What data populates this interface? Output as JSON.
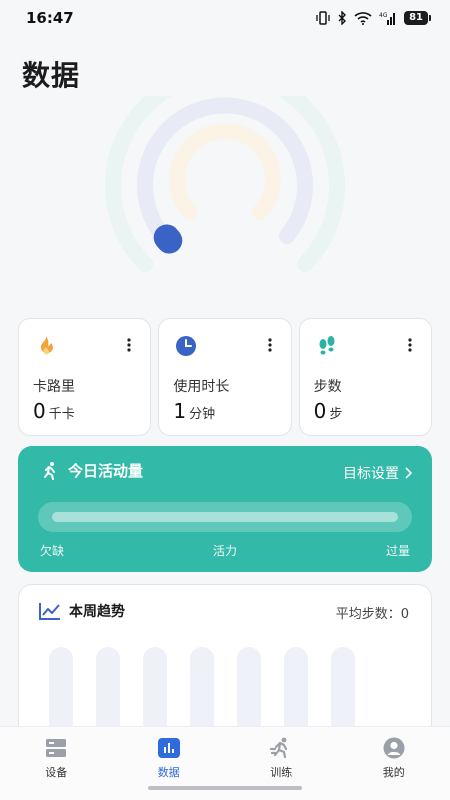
{
  "status": {
    "time": "16:47",
    "battery": "81"
  },
  "page_title": "数据",
  "cards": [
    {
      "label": "卡路里",
      "value": "0",
      "unit": "千卡",
      "icon": "flame-icon"
    },
    {
      "label": "使用时长",
      "value": "1",
      "unit": "分钟",
      "icon": "clock-icon"
    },
    {
      "label": "步数",
      "value": "0",
      "unit": "步",
      "icon": "footprints-icon"
    }
  ],
  "activity": {
    "title": "今日活动量",
    "link_label": "目标设置",
    "scale": [
      "欠缺",
      "活力",
      "过量"
    ],
    "accent": "#32b9a8"
  },
  "trend": {
    "title": "本周趋势",
    "avg_label": "平均步数：0"
  },
  "nav": [
    {
      "label": "设备",
      "icon": "device-icon",
      "active": false
    },
    {
      "label": "数据",
      "icon": "bar-chart-icon",
      "active": true
    },
    {
      "label": "训练",
      "icon": "running-icon",
      "active": false
    },
    {
      "label": "我的",
      "icon": "profile-icon",
      "active": false
    }
  ]
}
